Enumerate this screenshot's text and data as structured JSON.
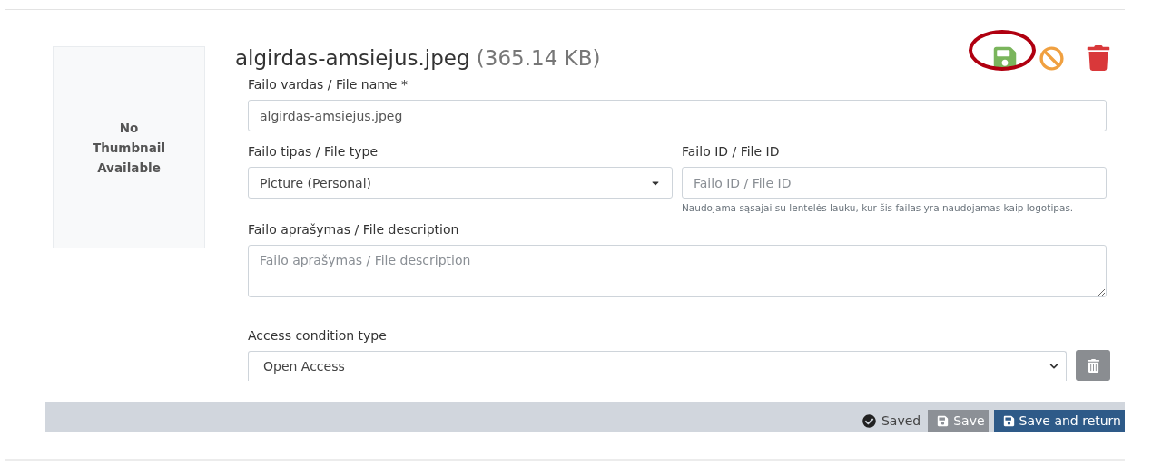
{
  "file": {
    "name": "algirdas-amsiejus.jpeg",
    "size": "(365.14 KB)"
  },
  "thumbnail": {
    "text": "No Thumbnail Available"
  },
  "actions": [
    {
      "kind": "save",
      "highlighted": true
    },
    {
      "kind": "cancel",
      "highlighted": false
    },
    {
      "kind": "delete",
      "highlighted": false
    }
  ],
  "file_name": {
    "label": "Failo vardas / File name *",
    "value": "algirdas-amsiejus.jpeg"
  },
  "file_type": {
    "label": "Failo tipas / File type",
    "value": "Picture (Personal)"
  },
  "file_id": {
    "label": "Failo ID / File ID",
    "placeholder": "Failo ID / File ID",
    "hint": "Naudojama sąsajai su lentelės lauku, kur šis failas yra naudojamas kaip logotipas."
  },
  "description": {
    "label": "Failo aprašymas / File description",
    "placeholder": "Failo aprašymas / File description"
  },
  "access_condition": {
    "label": "Access condition type",
    "value": "Open Access"
  },
  "footer": {
    "status": "Saved",
    "buttons": [
      {
        "kind": "secondary",
        "label": "Save"
      },
      {
        "kind": "primary",
        "label": "Save and return"
      }
    ]
  }
}
